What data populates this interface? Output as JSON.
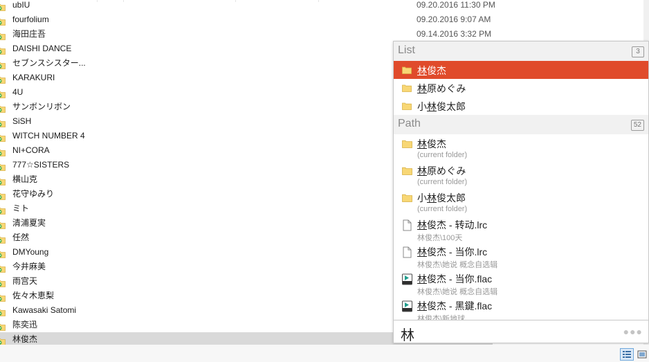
{
  "file_list": {
    "rows": [
      {
        "name": "ubIU",
        "date": "09.20.2016 11:30 PM"
      },
      {
        "name": "fourfolium",
        "date": "09.20.2016 9:07 AM"
      },
      {
        "name": "海田庄吾",
        "date": "09.14.2016 3:32 PM"
      },
      {
        "name": "DAISHI DANCE",
        "date": ""
      },
      {
        "name": "セブンスシスター...",
        "date": ""
      },
      {
        "name": "KARAKURI",
        "date": ""
      },
      {
        "name": "4U",
        "date": ""
      },
      {
        "name": "サンボンリボン",
        "date": ""
      },
      {
        "name": "SiSH",
        "date": ""
      },
      {
        "name": "WITCH NUMBER 4",
        "date": ""
      },
      {
        "name": "NI+CORA",
        "date": ""
      },
      {
        "name": "777☆SISTERS",
        "date": ""
      },
      {
        "name": "横山克",
        "date": ""
      },
      {
        "name": "花守ゆみり",
        "date": ""
      },
      {
        "name": "ミト",
        "date": ""
      },
      {
        "name": "清浦夏実",
        "date": ""
      },
      {
        "name": "任然",
        "date": ""
      },
      {
        "name": "DMYoung",
        "date": ""
      },
      {
        "name": "今井麻美",
        "date": ""
      },
      {
        "name": "雨宫天",
        "date": ""
      },
      {
        "name": "佐々木恵梨",
        "date": ""
      },
      {
        "name": "Kawasaki Satomi",
        "date": ""
      },
      {
        "name": "陈奕迅",
        "date": ""
      },
      {
        "name": "林俊杰",
        "date": ""
      }
    ]
  },
  "popup": {
    "list_section": {
      "title": "List",
      "count": "3",
      "items": [
        {
          "hl": "林",
          "rest": "俊杰",
          "pre": ""
        },
        {
          "hl": "林",
          "rest": "原めぐみ",
          "pre": ""
        },
        {
          "pre": "小",
          "hl": "林",
          "rest": "俊太郎"
        }
      ]
    },
    "path_section": {
      "title": "Path",
      "count": "52",
      "items": [
        {
          "pre": "",
          "hl": "林",
          "rest": "俊杰",
          "sub": "(current folder)",
          "icon": "folder-icon"
        },
        {
          "pre": "",
          "hl": "林",
          "rest": "原めぐみ",
          "sub": "(current folder)",
          "icon": "folder-icon"
        },
        {
          "pre": "小",
          "hl": "林",
          "rest": "俊太郎",
          "sub": "(current folder)",
          "icon": "folder-icon"
        },
        {
          "pre": "",
          "hl": "林",
          "rest": "俊杰 - 转动.lrc",
          "sub": "林俊杰\\100天",
          "icon": "document-icon"
        },
        {
          "pre": "",
          "hl": "林",
          "rest": "俊杰 - 当你.lrc",
          "sub": "林俊杰\\她说 概念自选辑",
          "icon": "document-icon"
        },
        {
          "pre": "",
          "hl": "林",
          "rest": "俊杰 - 当你.flac",
          "sub": "林俊杰\\她说 概念自选辑",
          "icon": "flac-icon"
        },
        {
          "pre": "",
          "hl": "林",
          "rest": "俊杰 - 黑鍵.flac",
          "sub": "林俊杰\\新地球",
          "icon": "flac-icon"
        }
      ]
    },
    "search": {
      "query": "林",
      "more": "●●●"
    }
  },
  "colors": {
    "highlight": "#e04b2b",
    "folder": "#f8d775",
    "selected_row": "#d9d9d9",
    "flac_icon": "#1e9c8c"
  }
}
